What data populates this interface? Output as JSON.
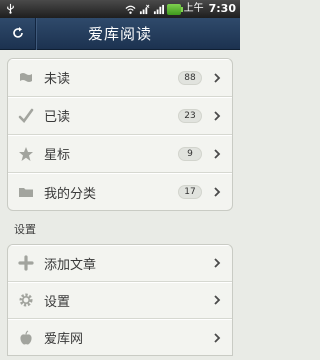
{
  "status_bar": {
    "time": "7:30",
    "am_pm": "上午",
    "icons": [
      "usb-icon",
      "wifi-icon",
      "signal-muted-icon",
      "signal-icon",
      "battery-icon"
    ]
  },
  "header": {
    "title": "爱库阅读",
    "refresh_icon": "refresh-icon"
  },
  "main_list": [
    {
      "label": "未读",
      "count": "88",
      "icon": "flag-icon"
    },
    {
      "label": "已读",
      "count": "23",
      "icon": "check-icon"
    },
    {
      "label": "星标",
      "count": "9",
      "icon": "star-icon"
    },
    {
      "label": "我的分类",
      "count": "17",
      "icon": "folder-icon"
    }
  ],
  "settings_section": {
    "title": "设置",
    "items": [
      {
        "label": "添加文章",
        "icon": "plus-icon"
      },
      {
        "label": "设置",
        "icon": "gear-icon"
      },
      {
        "label": "爱库网",
        "icon": "apple-icon"
      }
    ]
  },
  "colors": {
    "header_bg": "#24405f",
    "background": "#e9ebe6",
    "icon_gray": "#9ea09a"
  }
}
